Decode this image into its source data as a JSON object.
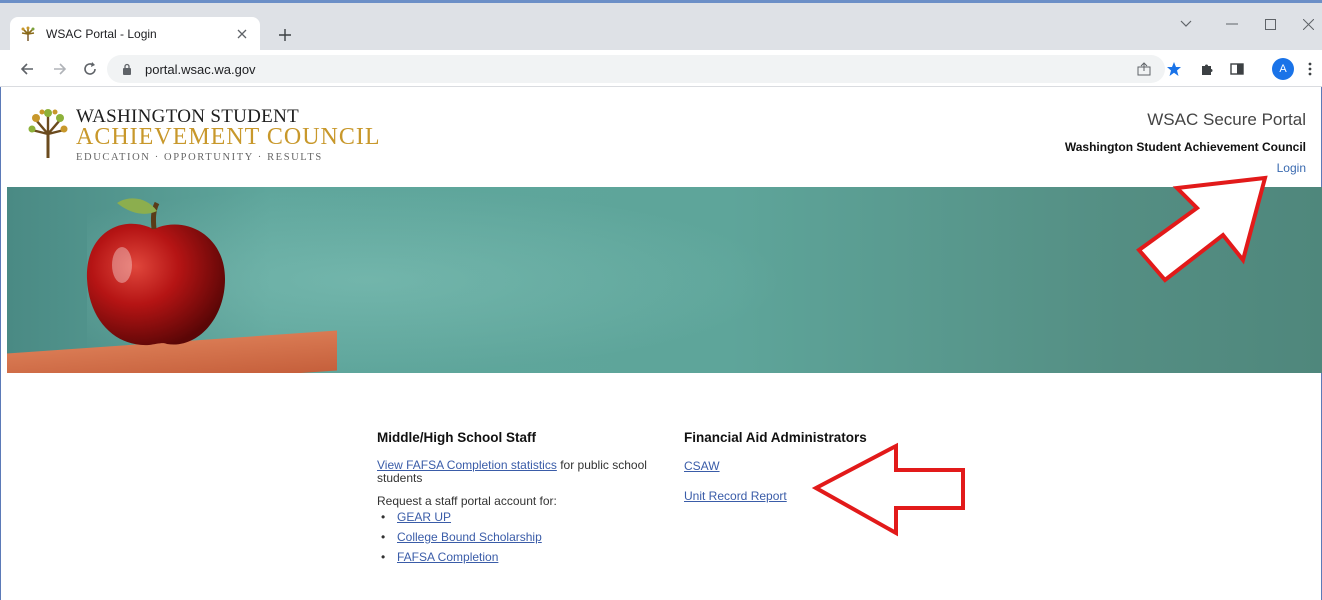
{
  "browser": {
    "tab_title": "WSAC Portal - Login",
    "url": "portal.wsac.wa.gov",
    "profile_initial": "A",
    "accent_color": "#1a73e8"
  },
  "header": {
    "logo_line1": "WASHINGTON STUDENT",
    "logo_line2": "ACHIEVEMENT COUNCIL",
    "logo_tagline": "EDUCATION · OPPORTUNITY · RESULTS",
    "portal_title": "WSAC Secure Portal",
    "org_name": "Washington Student Achievement Council",
    "login_label": "Login"
  },
  "school_staff": {
    "heading": "Middle/High School Staff",
    "fafsa_stats_link": "View FAFSA Completion statistics",
    "fafsa_stats_suffix": " for public school students",
    "request_text": "Request a staff portal account for:",
    "programs": [
      "GEAR UP",
      "College Bound Scholarship",
      "FAFSA Completion"
    ]
  },
  "financial_aid": {
    "heading": "Financial Aid Administrators",
    "links": [
      "CSAW",
      "Unit Record Report"
    ]
  },
  "annotations": {
    "arrow_color": "#e21a1a"
  }
}
